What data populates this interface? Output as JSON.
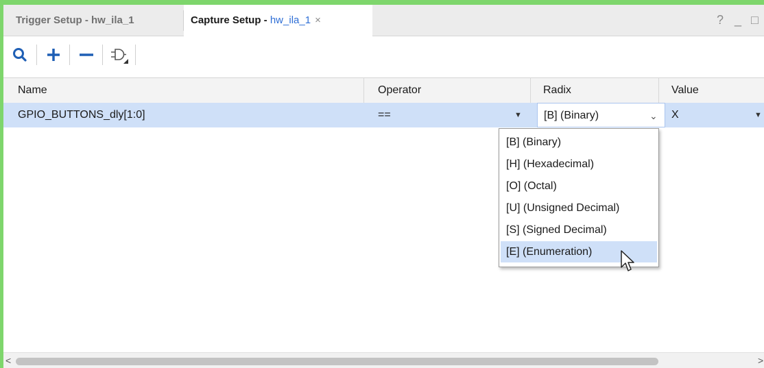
{
  "tabs": [
    {
      "label": "Trigger Setup - hw_ila_1",
      "active": false
    },
    {
      "label_prefix": "Capture Setup - ",
      "label_link": "hw_ila_1",
      "close": "×",
      "active": true
    }
  ],
  "window_controls": {
    "help": "?",
    "minimize": "_",
    "maximize": "□"
  },
  "toolbar": {
    "buttons": [
      {
        "icon": "search-icon"
      },
      {
        "icon": "plus-icon"
      },
      {
        "icon": "minus-icon"
      },
      {
        "icon": "gate-icon"
      }
    ]
  },
  "table": {
    "columns": [
      "Name",
      "Operator",
      "Radix",
      "Value"
    ],
    "rows": [
      {
        "name": "GPIO_BUTTONS_dly[1:0]",
        "operator": "==",
        "radix": "[B] (Binary)",
        "value": "X"
      }
    ]
  },
  "radix_dropdown": {
    "options": [
      "[B] (Binary)",
      "[H] (Hexadecimal)",
      "[O] (Octal)",
      "[U] (Unsigned Decimal)",
      "[S] (Signed Decimal)",
      "[E] (Enumeration)"
    ],
    "highlighted": "[E] (Enumeration)"
  },
  "scrollbar": {
    "left_arrow": "<",
    "right_arrow": ">"
  },
  "colors": {
    "accent_border": "#7ed66c",
    "selection": "#cfe0f8",
    "link": "#2f6fd6"
  }
}
